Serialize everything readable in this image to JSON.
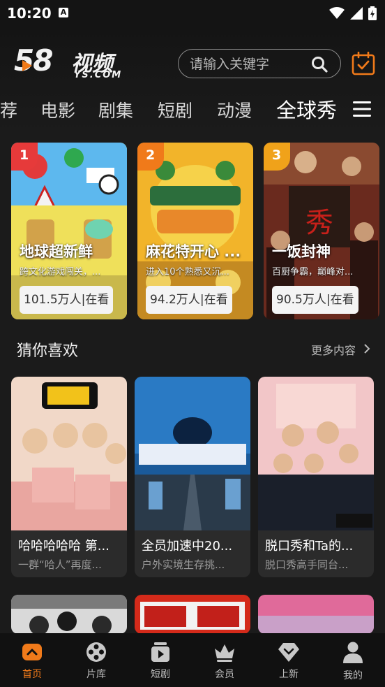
{
  "status": {
    "time": "10:20",
    "notif": "A"
  },
  "app": {
    "logo_main": "58",
    "logo_video": "视频",
    "logo_sub": "YS.COM"
  },
  "search": {
    "placeholder": "请输入关键字"
  },
  "tabs": [
    {
      "label": "荐",
      "active": false
    },
    {
      "label": "电影",
      "active": false
    },
    {
      "label": "剧集",
      "active": false
    },
    {
      "label": "短剧",
      "active": false
    },
    {
      "label": "动漫",
      "active": false
    },
    {
      "label": "全球秀",
      "active": true
    }
  ],
  "rank": {
    "items": [
      {
        "rank": "1",
        "name": "地球超新鲜",
        "desc": "跨文化游戏闯关，...",
        "heat": "101.5万人|在看"
      },
      {
        "rank": "2",
        "name": "麻花特开心 ...",
        "desc": "进入10个熟悉又沉...",
        "heat": "94.2万人|在看"
      },
      {
        "rank": "3",
        "name": "一饭封神",
        "desc": "百厨争霸，巅峰对...",
        "heat": "90.5万人|在看"
      }
    ]
  },
  "section": {
    "title": "猜你喜欢",
    "more": "更多内容"
  },
  "recommend": [
    {
      "title": "哈哈哈哈哈 第...",
      "sub": "一群“哈人”再度..."
    },
    {
      "title": "全员加速中20...",
      "sub": "户外实境生存挑..."
    },
    {
      "title": "脱口秀和Ta的...",
      "sub": "脱口秀高手同台..."
    }
  ],
  "nav": [
    {
      "label": "首页",
      "icon": "home-icon",
      "active": true
    },
    {
      "label": "片库",
      "icon": "film-reel-icon",
      "active": false
    },
    {
      "label": "短剧",
      "icon": "short-play-icon",
      "active": false
    },
    {
      "label": "会员",
      "icon": "crown-icon",
      "active": false
    },
    {
      "label": "上新",
      "icon": "diamond-icon",
      "active": false
    },
    {
      "label": "我的",
      "icon": "profile-icon",
      "active": false
    }
  ],
  "colors": {
    "accent": "#f07a1a",
    "background": "#1b1b1b",
    "card": "#2b2b2b"
  }
}
